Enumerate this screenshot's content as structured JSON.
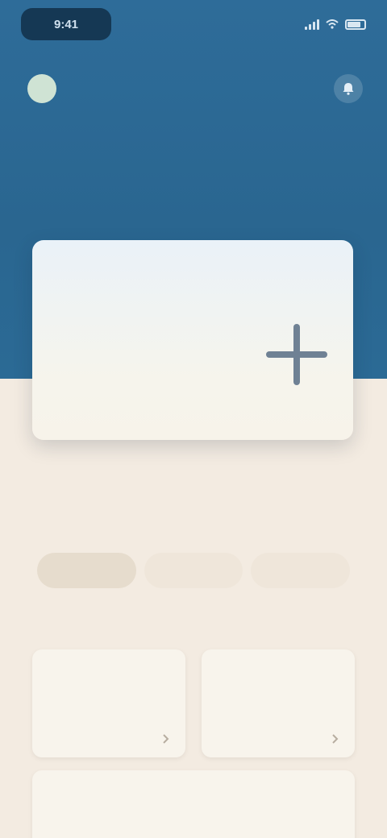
{
  "status_bar": {
    "time": "9:41",
    "battery_icon": "battery-icon",
    "signal_icon": "signal-icon",
    "wifi_icon": "wifi-icon"
  },
  "header": {
    "avatar_initial": "",
    "greeting": "",
    "subtitle": "",
    "notification_icon": "bell-icon"
  },
  "hero_card": {
    "title": "",
    "subtitle": "",
    "meta": "",
    "add_icon": "plus-icon"
  },
  "section": {
    "title": ""
  },
  "filters": [
    {
      "label": "",
      "active": true
    },
    {
      "label": "",
      "active": false
    },
    {
      "label": "",
      "active": false
    }
  ],
  "tiles": [
    {
      "title": "",
      "subtitle": ""
    },
    {
      "title": "",
      "subtitle": ""
    }
  ],
  "bottom_card": {
    "title": ""
  },
  "colors": {
    "header_blue": "#2e6c99",
    "background": "#f3ebe1",
    "card": "#f8f4ec",
    "status_pill": "#153854"
  }
}
